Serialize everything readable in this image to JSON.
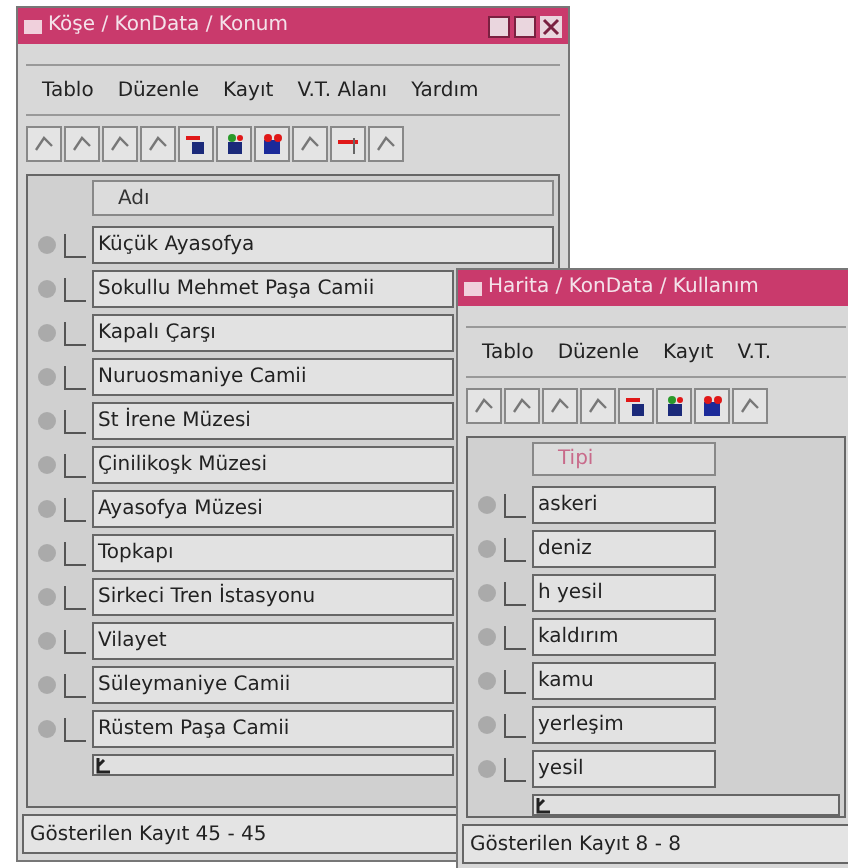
{
  "windows": [
    {
      "title": "Köşe / KonData / Konum",
      "menu": [
        "Tablo",
        "Düzenle",
        "Kayıt",
        "V.T. Alanı",
        "Yardım"
      ],
      "toolbar": [
        {
          "kind": "grey"
        },
        {
          "kind": "grey"
        },
        {
          "kind": "grey"
        },
        {
          "kind": "grey"
        },
        {
          "kind": "red"
        },
        {
          "kind": "green"
        },
        {
          "kind": "blue"
        },
        {
          "kind": "grey"
        },
        {
          "kind": "redline"
        },
        {
          "kind": "grey"
        }
      ],
      "column": "Adı",
      "rows": [
        "Küçük Ayasofya",
        "Sokullu Mehmet Paşa Camii",
        "Kapalı Çarşı",
        "Nuruosmaniye Camii",
        "St İrene Müzesi",
        "Çinilikoşk Müzesi",
        "Ayasofya Müzesi",
        "Topkapı",
        "Sirkeci Tren İstasyonu",
        "Vilayet",
        "Süleymaniye Camii",
        "Rüstem Paşa Camii"
      ],
      "status": "Gösterilen Kayıt 45 - 45"
    },
    {
      "title": "Harita / KonData / Kullanım",
      "menu": [
        "Tablo",
        "Düzenle",
        "Kayıt",
        "V.T."
      ],
      "toolbar": [
        {
          "kind": "grey"
        },
        {
          "kind": "grey"
        },
        {
          "kind": "grey"
        },
        {
          "kind": "grey"
        },
        {
          "kind": "red"
        },
        {
          "kind": "green"
        },
        {
          "kind": "blue"
        },
        {
          "kind": "grey"
        }
      ],
      "column": "Tipi",
      "rows": [
        "askeri",
        "deniz",
        "h yesil",
        "kaldırım",
        "kamu",
        "yerleşim",
        "yesil"
      ],
      "status": "Gösterilen Kayıt 8 - 8"
    }
  ]
}
